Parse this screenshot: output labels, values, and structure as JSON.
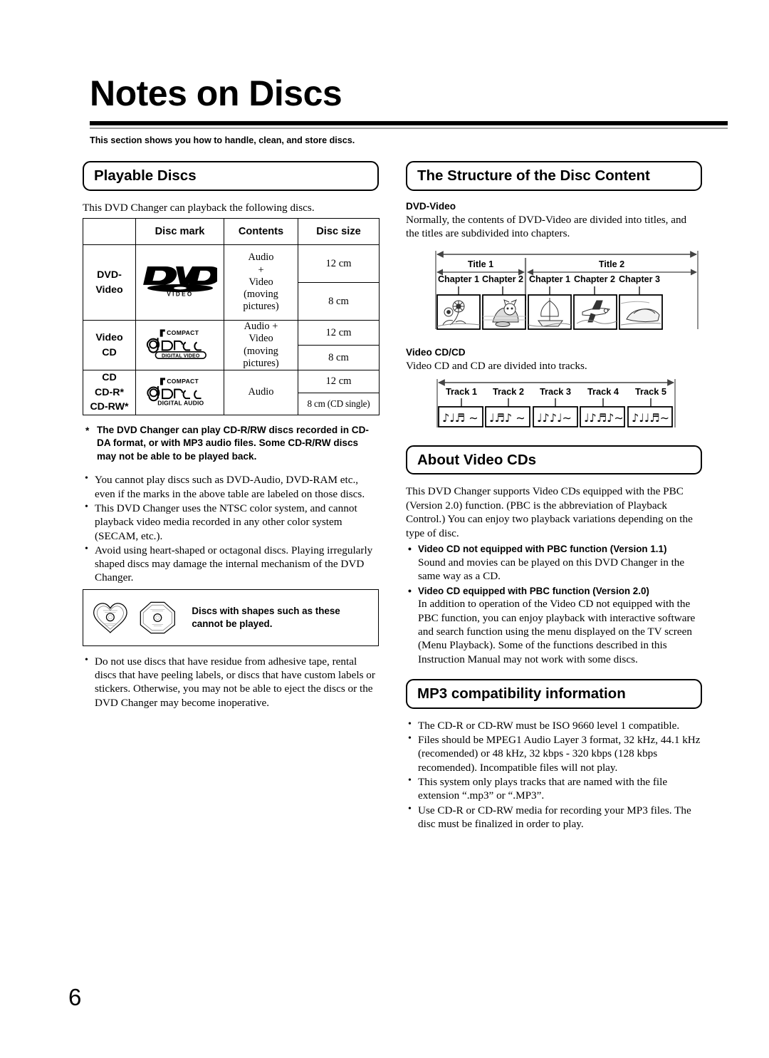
{
  "page": {
    "title": "Notes on Discs",
    "intro": "This section shows you how to handle, clean, and store discs.",
    "number": "6"
  },
  "playable_discs": {
    "heading": "Playable Discs",
    "lead": "This DVD Changer can playback the following discs.",
    "table": {
      "headers": [
        "",
        "Disc mark",
        "Contents",
        "Disc size"
      ],
      "rows": [
        {
          "category": "DVD-\nVideo",
          "mark": "dvd-video-logo",
          "mark_text": "DVD VIDEO",
          "contents": "Audio\n+\nVideo\n(moving\npictures)",
          "sizes": [
            "12 cm",
            "8 cm"
          ]
        },
        {
          "category": "Video\nCD",
          "mark": "compact-disc-digital-video-logo",
          "mark_text": "COMPACT disc DIGITAL VIDEO",
          "contents": "Audio +\nVideo\n(moving\npictures)",
          "sizes": [
            "12 cm",
            "8 cm"
          ]
        },
        {
          "category": "CD\nCD-R*\nCD-RW*",
          "mark": "compact-disc-digital-audio-logo",
          "mark_text": "COMPACT disc DIGITAL AUDIO",
          "contents": "Audio",
          "sizes": [
            "12 cm",
            "8 cm (CD single)"
          ]
        }
      ]
    },
    "footnote": "The DVD Changer can play CD-R/RW discs recorded in CD-DA format, or with MP3 audio files. Some CD-R/RW discs may not be able to be played back.",
    "bullets": [
      "You cannot play discs such as DVD-Audio, DVD-RAM etc., even if the marks in the above table are labeled on those discs.",
      "This DVD Changer uses the NTSC color system, and cannot playback video media recorded in any other color system (SECAM, etc.).",
      "Avoid using heart-shaped or octagonal discs. Playing irregularly shaped discs may damage the internal mechanism of the DVD Changer."
    ],
    "shape_warning": {
      "caption": "Discs with shapes such as these cannot be played.",
      "shapes": [
        "heart-shaped-disc",
        "octagonal-disc"
      ]
    },
    "bullets_after": [
      "Do not use discs that have residue from adhesive tape, rental discs that have peeling labels, or discs that have custom labels or stickers. Otherwise, you may not be able to eject the discs or the DVD Changer may become inoperative."
    ]
  },
  "disc_structure": {
    "heading": "The Structure of the Disc Content",
    "dvd_video": {
      "sub_heading": "DVD-Video",
      "text": "Normally, the contents of DVD-Video are divided into titles, and the titles are subdivided into chapters.",
      "titles": [
        {
          "label": "Title 1",
          "chapters": [
            "Chapter 1",
            "Chapter 2"
          ],
          "thumbs": [
            "flowers",
            "cat"
          ]
        },
        {
          "label": "Title 2",
          "chapters": [
            "Chapter 1",
            "Chapter 2",
            "Chapter 3"
          ],
          "thumbs": [
            "sailing-ship",
            "airplane",
            "car"
          ]
        }
      ]
    },
    "video_cd": {
      "sub_heading": "Video CD/CD",
      "text": "Video CD and CD are divided into tracks.",
      "tracks": [
        "Track 1",
        "Track 2",
        "Track 3",
        "Track 4",
        "Track 5"
      ],
      "track_glyphs": [
        "♪♪♫  〜",
        "♩♫♪ 〜",
        "♩♪♪♩ 〜",
        "♩♪♫♪〜",
        "♪♩♩♫〜"
      ]
    }
  },
  "about_video_cds": {
    "heading": "About Video CDs",
    "intro": "This DVD Changer supports Video CDs equipped with the PBC (Version 2.0) function. (PBC is the abbreviation of Playback Control.) You can enjoy two playback variations depending on the type of disc.",
    "items": [
      {
        "title": "Video CD not equipped with PBC function (Version 1.1)",
        "body": "Sound and movies can be played on this DVD Changer in the same way as a CD."
      },
      {
        "title": "Video CD equipped with PBC function (Version 2.0)",
        "body": "In addition to operation of the Video CD not equipped with the PBC function, you can enjoy playback with interactive software and search function using the menu displayed on the TV screen (Menu Playback). Some of the functions described in this Instruction Manual may not work with some discs."
      }
    ]
  },
  "mp3_info": {
    "heading": "MP3 compatibility information",
    "bullets": [
      "The CD-R or CD-RW must be ISO 9660 level 1 compatible.",
      "Files should be MPEG1 Audio Layer 3 format, 32 kHz, 44.1 kHz (recomended) or 48 kHz, 32 kbps - 320 kbps (128 kbps recomended). Incompatible files will not play.",
      "This system only plays tracks that are named with the file extension “.mp3” or “.MP3”.",
      "Use CD-R or CD-RW media for recording your MP3 files. The disc must be finalized in order to play."
    ]
  }
}
